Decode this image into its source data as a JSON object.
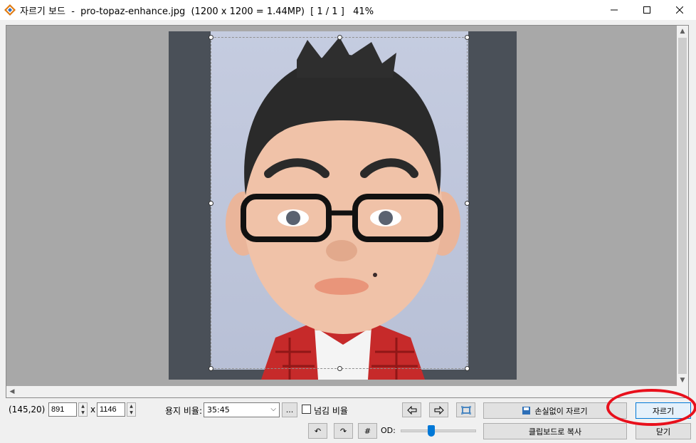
{
  "window": {
    "title": "자르기 보드  -  pro-topaz-enhance.jpg  (1200 x 1200 = 1.44MP)  [ 1 / 1 ]   41%",
    "minimize_icon": "minimize-icon",
    "maximize_icon": "maximize-icon",
    "close_icon": "close-icon"
  },
  "controls": {
    "position": "(145,20)",
    "width_value": "891",
    "height_value": "1146",
    "times": "x",
    "ratio_label": "용지 비율:",
    "ratio_value": "35:45",
    "ellipsis": "...",
    "overflow_label": "넘김 비율",
    "overflow_checked": false,
    "od_label": "OD:",
    "od_level_fraction": 0.4,
    "lossless_crop": "손실없이 자르기",
    "crop": "자르기",
    "copy_clipboard": "클립보드로 복사",
    "close": "닫기"
  },
  "colors": {
    "accent": "#0078d7",
    "highlight_ring": "#e8101c",
    "canvas_bg": "#a8a8a8"
  }
}
